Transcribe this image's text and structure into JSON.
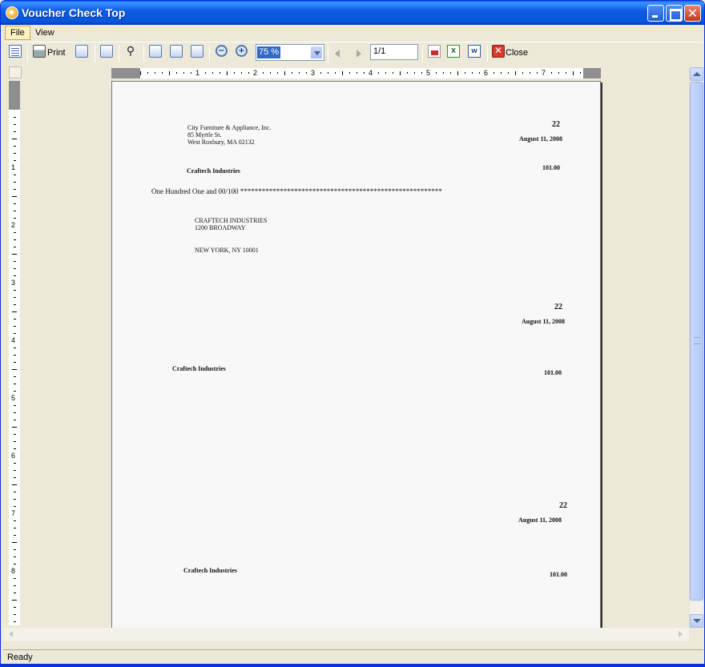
{
  "window": {
    "title": "Voucher Check Top"
  },
  "menu": {
    "file": "File",
    "view": "View"
  },
  "toolbar": {
    "print_label": "Print",
    "zoom_value": "75 %",
    "page_value": "1/1",
    "close_label": "Close"
  },
  "ruler": {
    "h_numbers": [
      "1",
      "2",
      "3",
      "4",
      "5",
      "6",
      "7"
    ],
    "v_numbers": [
      "1",
      "2",
      "3",
      "4",
      "5",
      "6",
      "7",
      "8"
    ]
  },
  "check": {
    "company_name": "City Furniture & Appliance, Inc.",
    "company_street": "85 Myrtle St.",
    "company_city": "West Roxbury, MA 02132",
    "check_number": "22",
    "date": "August 11, 2008",
    "payee": "Craftech Industries",
    "amount": "101.00",
    "amount_words": "One Hundred One and 00/100 ********************************************************",
    "address_line1": "CRAFTECH INDUSTRIES",
    "address_line2": "1200 BROADWAY",
    "address_line3": "NEW YORK, NY 10001"
  },
  "stub1": {
    "check_number": "22",
    "date": "August 11, 2008",
    "payee": "Craftech Industries",
    "amount": "101.00"
  },
  "stub2": {
    "check_number": "22",
    "date": "August 11, 2008",
    "payee": "Craftech Industries",
    "amount": "101.00"
  },
  "status": {
    "text": "Ready"
  }
}
